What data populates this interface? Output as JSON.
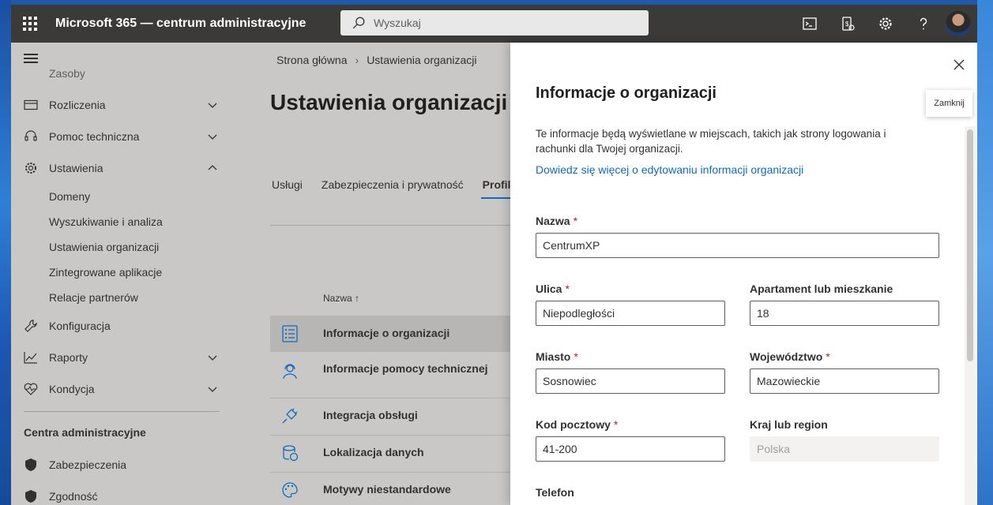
{
  "app": {
    "title": "Microsoft 365 — centrum administracyjne",
    "search_placeholder": "Wyszukaj",
    "accent_color": "#0f6cbd"
  },
  "top_icons": [
    "terminal-icon",
    "mobile-app-icon",
    "gear-icon",
    "help-icon"
  ],
  "nav": {
    "partial_top_label": "Zasoby",
    "items": [
      {
        "label": "Rozliczenia",
        "icon": "credit-card-icon",
        "expanded": false
      },
      {
        "label": "Pomoc techniczna",
        "icon": "headset-icon",
        "expanded": false
      },
      {
        "label": "Ustawienia",
        "icon": "gear-icon",
        "expanded": true
      }
    ],
    "settings_subitems": [
      "Domeny",
      "Wyszukiwanie i analiza",
      "Ustawienia organizacji",
      "Zintegrowane aplikacje",
      "Relacje partnerów"
    ],
    "items2": [
      {
        "label": "Konfiguracja",
        "icon": "wrench-icon"
      },
      {
        "label": "Raporty",
        "icon": "chart-icon"
      },
      {
        "label": "Kondycja",
        "icon": "heart-pulse-icon"
      }
    ],
    "section_title": "Centra administracyjne",
    "admin_centers": [
      {
        "label": "Zabezpieczenia",
        "icon": "shield-icon"
      },
      {
        "label": "Zgodność",
        "icon": "shield-icon"
      }
    ]
  },
  "main": {
    "breadcrumb": [
      "Strona główna",
      "Ustawienia organizacji"
    ],
    "title": "Ustawienia organizacji",
    "tabs": [
      "Usługi",
      "Zabezpieczenia i prywatność",
      "Profil o"
    ],
    "column_header": "Nazwa ↑",
    "rows": [
      {
        "label": "Informacje o organizacji",
        "icon": "list-icon",
        "selected": true
      },
      {
        "label": "Informacje pomocy technicznej",
        "icon": "person-headset-icon",
        "selected": false
      },
      {
        "label": "Integracja obsługi",
        "icon": "plug-icon",
        "selected": false
      },
      {
        "label": "Lokalizacja danych",
        "icon": "database-globe-icon",
        "selected": false
      },
      {
        "label": "Motywy niestandardowe",
        "icon": "palette-icon",
        "selected": false
      }
    ]
  },
  "panel": {
    "title": "Informacje o organizacji",
    "description": "Te informacje będą wyświetlane w miejscach, takich jak strony logowania i rachunki dla Twojej organizacji.",
    "link": "Dowiedz się więcej o edytowaniu informacji organizacji",
    "close_tooltip": "Zamknij",
    "required_marker": "*",
    "fields": {
      "name": {
        "label": "Nazwa",
        "value": "CentrumXP",
        "required": true
      },
      "street": {
        "label": "Ulica",
        "value": "Niepodległości",
        "required": true
      },
      "apartment": {
        "label": "Apartament lub mieszkanie",
        "value": "18",
        "required": false
      },
      "city": {
        "label": "Miasto",
        "value": "Sosnowiec",
        "required": true
      },
      "province": {
        "label": "Województwo",
        "value": "Mazowieckie",
        "required": true
      },
      "postal": {
        "label": "Kod pocztowy",
        "value": "41-200",
        "required": true
      },
      "country": {
        "label": "Kraj lub region",
        "value": "Polska",
        "required": false
      },
      "phone": {
        "label": "Telefon"
      }
    }
  }
}
